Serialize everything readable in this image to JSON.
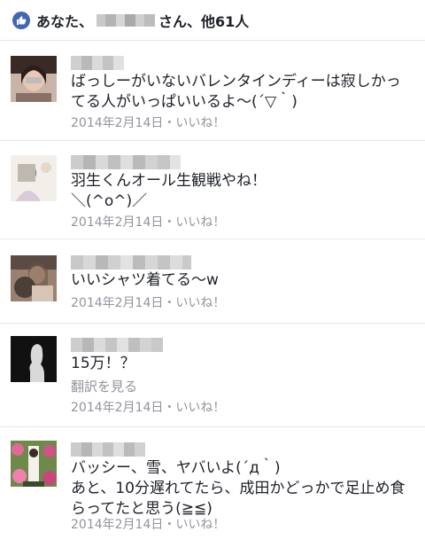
{
  "likes": {
    "prefix": "あなた、",
    "suffix": "さん、他61人",
    "accent": "#4267b2"
  },
  "comments": [
    {
      "lines": [
        "ばっしーがいないバレンタインディーは寂しかっ",
        "てる人がいっぱいいるよ〜(´▽｀)"
      ],
      "date": "2014年2月14日",
      "sep": "・",
      "like": "いいね！"
    },
    {
      "lines": [
        "羽生くんオール生観戦やね！",
        "＼(^o^)／"
      ],
      "date": "2014年2月14日",
      "sep": "・",
      "like": "いいね！"
    },
    {
      "lines": [
        "いいシャツ着てる〜w"
      ],
      "date": "2014年2月14日",
      "sep": "・",
      "like": "いいね！"
    },
    {
      "lines": [
        "15万！？"
      ],
      "translate": "翻訳を見る",
      "date": "2014年2月14日",
      "sep": "・",
      "like": "いいね！"
    },
    {
      "lines": [
        "バッシー、雪、ヤバいよ(´д｀)",
        "あと、10分遅れてたら、成田かどっかで足止め食",
        "らってたと思う(≧≦)"
      ],
      "date": "2014年2月14日",
      "sep": "・",
      "like": "いいね！"
    }
  ]
}
